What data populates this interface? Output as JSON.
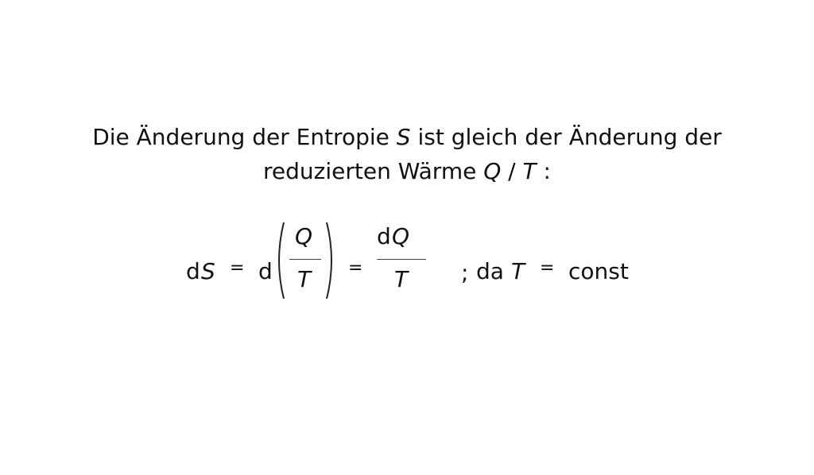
{
  "intro": {
    "line1_pre": "Die Änderung der Entropie ",
    "line1_var": "S",
    "line1_post": " ist gleich der Änderung der",
    "line2_pre": "reduzierten Wärme ",
    "line2_var1": "Q",
    "line2_slash": " / ",
    "line2_var2": "T",
    "line2_post": " :"
  },
  "formula": {
    "d1": "d",
    "S": "S",
    "eq1": "=",
    "d2": "d",
    "frac1_num": "Q",
    "frac1_den": "T",
    "eq2": "=",
    "frac2_num_d": "d",
    "frac2_num_var": "Q",
    "frac2_den": "T",
    "semicolon": ";",
    "da": "da",
    "T": "T",
    "eq3": "=",
    "const": "const"
  }
}
